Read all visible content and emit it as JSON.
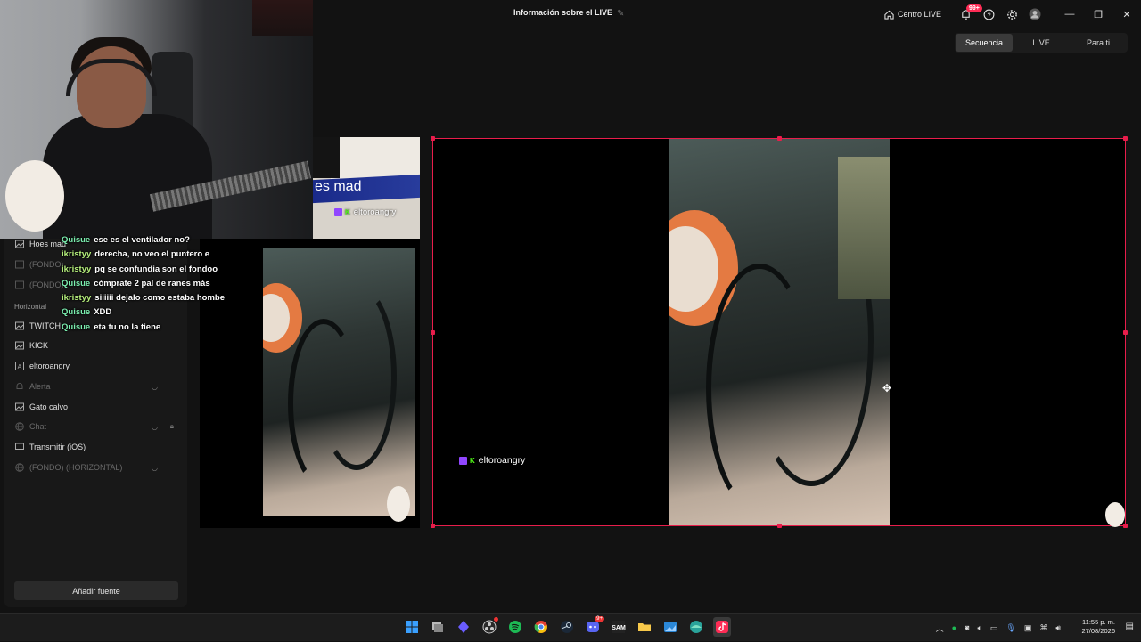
{
  "titlebar": {
    "title": "Información sobre el LIVE",
    "centro_label": "Centro LIVE",
    "notif_badge": "99+"
  },
  "view_tabs": [
    "Secuencia",
    "LIVE",
    "Para ti"
  ],
  "active_tab": "Secuencia",
  "sources": {
    "items": [
      {
        "label": "Hoes mad",
        "icon": "image-icon",
        "dim": false
      },
      {
        "label": "(FONDO)",
        "icon": "image-icon",
        "dim": true
      },
      {
        "label": "(FONDO)",
        "icon": "image-icon",
        "dim": true
      }
    ],
    "section_label": "Horizontal",
    "horizontal_items": [
      {
        "label": "TWITCH",
        "icon": "image-icon",
        "dim": false
      },
      {
        "label": "KICK",
        "icon": "image-icon",
        "dim": false
      },
      {
        "label": "eltoroangry",
        "icon": "text-icon",
        "dim": false
      },
      {
        "label": "Alerta",
        "icon": "bell-icon",
        "dim": true
      },
      {
        "label": "Gato calvo",
        "icon": "image-icon",
        "dim": false
      },
      {
        "label": "Chat",
        "icon": "globe-icon",
        "dim": true
      },
      {
        "label": "Transmitir (iOS)",
        "icon": "monitor-icon",
        "dim": false
      },
      {
        "label": "(FONDO) (HORIZONTAL)",
        "icon": "globe-icon",
        "dim": true
      }
    ],
    "add_button": "Añadir fuente"
  },
  "chat_messages": [
    {
      "user": "Quisue",
      "text": "ese es el ventilador no?"
    },
    {
      "user": "ikristyy",
      "text": "derecha, no veo el puntero e"
    },
    {
      "user": "ikristyy",
      "text": "pq se confundia son el fondoo"
    },
    {
      "user": "Quisue",
      "text": "cómprate 2 pal de ranes más"
    },
    {
      "user": "ikristyy",
      "text": "siiiiii dejalo como estaba hombe"
    },
    {
      "user": "Quisue",
      "text": "XDD"
    },
    {
      "user": "Quisue",
      "text": "eta tu no la tiene"
    }
  ],
  "overlay": {
    "banner_text": "es mad",
    "channel_name": "eltoroangry"
  },
  "colors": {
    "accent": "#fe2c55",
    "selection": "#e81d4b",
    "chat_user": "#7cf0b0",
    "twitch": "#9146ff",
    "kick": "#53fc18"
  },
  "taskbar": {
    "time": "11:55 p. m.",
    "date": "27/08/2026",
    "apps": [
      "windows-start-icon",
      "task-view-icon",
      "app-icon",
      "obs-icon",
      "spotify-icon",
      "chrome-icon",
      "steam-icon",
      "discord-icon",
      "sam-icon",
      "file-explorer-icon",
      "photos-icon",
      "browser-icon",
      "tiktok-live-icon"
    ],
    "discord_badge": "9+"
  }
}
